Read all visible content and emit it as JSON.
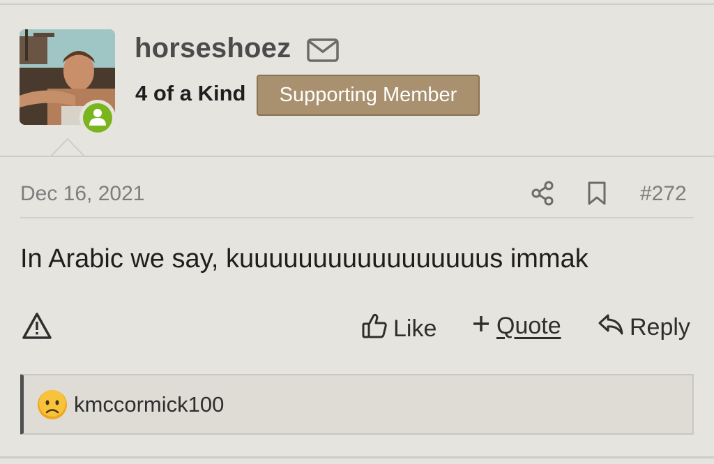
{
  "post": {
    "author": {
      "username": "horseshoez",
      "user_title": "4 of a Kind",
      "badge": "Supporting Member",
      "online": true,
      "avatar": "user-avatar-photo"
    },
    "date": "Dec 16, 2021",
    "number": "#272",
    "body": "In Arabic we say, kuuuuuuuuuuuuuuuuus immak",
    "actions": {
      "like_label": "Like",
      "quote_label": "Quote",
      "reply_label": "Reply"
    },
    "reactions": [
      {
        "emoji": "sad-face-emoji",
        "user": "kmccormick100"
      }
    ]
  },
  "icons": {
    "mail": "mail-icon",
    "share": "share-icon",
    "bookmark": "bookmark-icon",
    "report": "warning-triangle-icon",
    "like": "thumbs-up-icon",
    "quote": "plus-icon",
    "reply": "reply-arrow-icon",
    "online": "user-online-icon"
  },
  "colors": {
    "background": "#e6e4de",
    "badge": "#a9916f",
    "online": "#7ab51d",
    "muted_text": "#7d7d7d",
    "reaction_bar": "#4f4f4f"
  }
}
